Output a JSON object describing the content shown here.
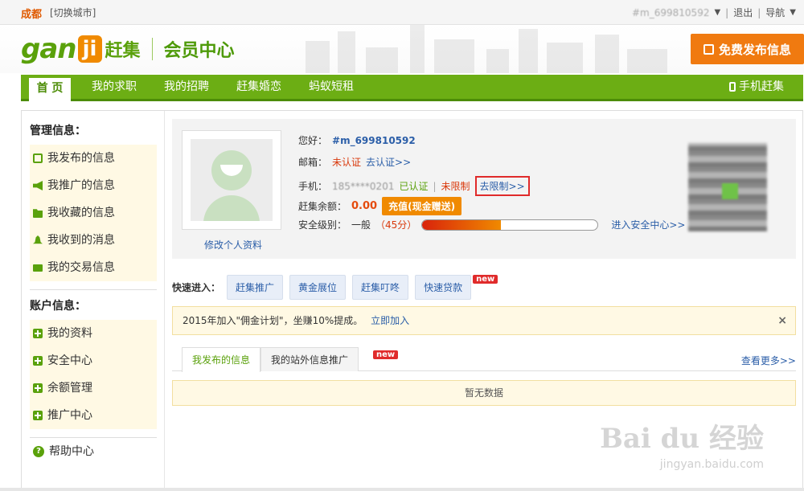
{
  "topbar": {
    "city": "成都",
    "switch_city": "[切换城市]",
    "username": "#m_699810592",
    "dropdown_arrow": "▼",
    "logout": "退出",
    "nav_menu": "导航",
    "nav_arrow": "▼"
  },
  "header": {
    "logo_text": "gan",
    "logo_badge": "ji",
    "logo_cn": "赶集",
    "member_center": "会员中心",
    "publish_button": "免费发布信息"
  },
  "nav": {
    "items": [
      {
        "label": "首 页",
        "active": true
      },
      {
        "label": "我的求职"
      },
      {
        "label": "我的招聘"
      },
      {
        "label": "赶集婚恋"
      },
      {
        "label": "蚂蚁短租"
      }
    ],
    "mobile": "手机赶集"
  },
  "sidebar": {
    "manage_title": "管理信息：",
    "manage_items": [
      {
        "label": "我发布的信息",
        "icon": "edit-icon"
      },
      {
        "label": "我推广的信息",
        "icon": "megaphone-icon"
      },
      {
        "label": "我收藏的信息",
        "icon": "folder-icon"
      },
      {
        "label": "我收到的消息",
        "icon": "bell-icon"
      },
      {
        "label": "我的交易信息",
        "icon": "mail-icon"
      }
    ],
    "account_title": "账户信息：",
    "account_items": [
      {
        "label": "我的资料"
      },
      {
        "label": "安全中心"
      },
      {
        "label": "余额管理"
      },
      {
        "label": "推广中心"
      }
    ],
    "help": "帮助中心"
  },
  "profile": {
    "edit_link": "修改个人资料",
    "hello_label": "您好：",
    "username": "#m_699810592",
    "email_label": "邮箱：",
    "email_status": "未认证",
    "email_action": "去认证>>",
    "phone_label": "手机：",
    "phone_number": "185****0201",
    "phone_status": "已认证",
    "phone_sep": "|",
    "phone_limit": "未限制",
    "phone_action": "去限制>>",
    "balance_label": "赶集余额：",
    "balance_value": "0.00",
    "recharge_button": "充值(现金赠送)",
    "security_label": "安全级别：",
    "security_level": "一般",
    "security_score": "（45分）",
    "security_progress": 0.45,
    "security_center_link": "进入安全中心>>"
  },
  "quick": {
    "label": "快速进入：",
    "buttons": [
      "赶集推广",
      "黄金展位",
      "赶集叮咚",
      "快速贷款"
    ],
    "new_badge": "new"
  },
  "notice": {
    "text": "2015年加入\"佣金计划\"，坐赚10%提成。",
    "link": "立即加入",
    "close": "×"
  },
  "tabs": {
    "items": [
      "我发布的信息",
      "我的站外信息推广"
    ],
    "new_badge": "new",
    "more": "查看更多>>"
  },
  "empty": {
    "text": "暂无数据"
  },
  "watermark": {
    "main": "Bai du 经验",
    "sub": "jingyan.baidu.com"
  },
  "colors": {
    "brand_green": "#6cae14",
    "brand_orange": "#f07a10",
    "link_blue": "#2b5ea8",
    "warning_red": "#d9380b"
  }
}
